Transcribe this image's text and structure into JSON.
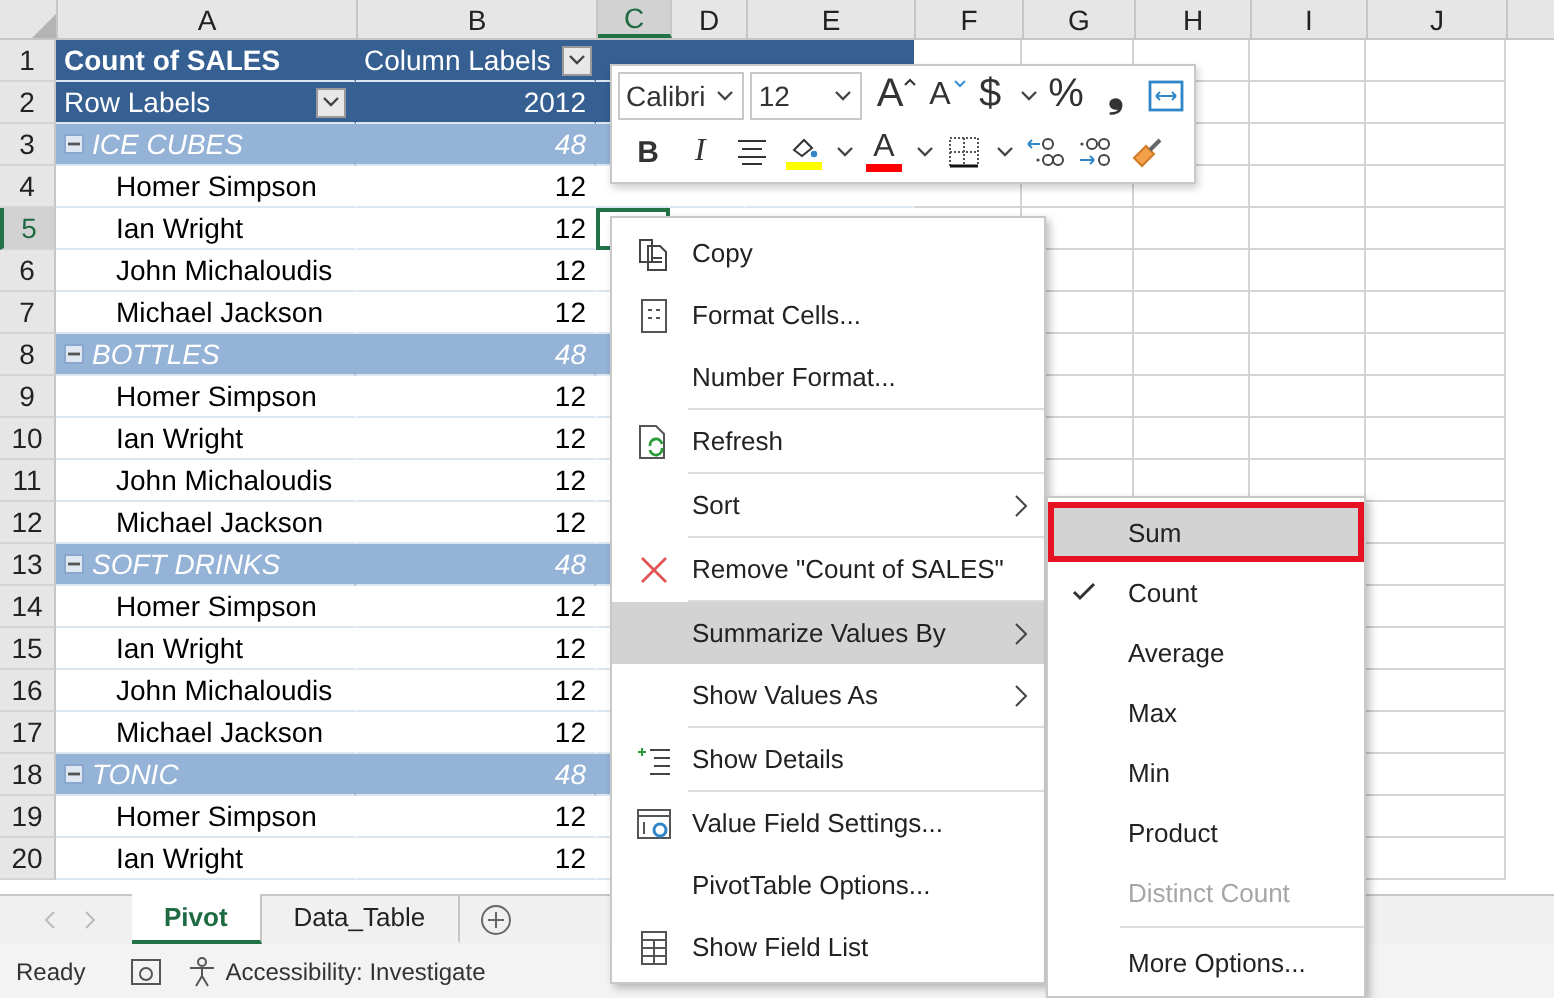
{
  "columns": [
    {
      "label": "A",
      "selected": false
    },
    {
      "label": "B",
      "selected": false
    },
    {
      "label": "C",
      "selected": true
    },
    {
      "label": "D",
      "selected": false
    },
    {
      "label": "E",
      "selected": false
    },
    {
      "label": "F",
      "selected": false
    },
    {
      "label": "G",
      "selected": false
    },
    {
      "label": "H",
      "selected": false
    },
    {
      "label": "I",
      "selected": false
    },
    {
      "label": "J",
      "selected": false
    }
  ],
  "rows": [
    {
      "number": "1",
      "kind": "title",
      "selected": false,
      "label": "Count of SALES",
      "value": "Column Labels",
      "filter": true
    },
    {
      "number": "2",
      "kind": "header",
      "selected": false,
      "label": "Row Labels",
      "value": "2012",
      "filter": true
    },
    {
      "number": "3",
      "kind": "group",
      "selected": false,
      "label": "ICE CUBES",
      "value": "48",
      "expanded": true
    },
    {
      "number": "4",
      "kind": "item",
      "selected": false,
      "label": "Homer Simpson",
      "value": "12"
    },
    {
      "number": "5",
      "kind": "item",
      "selected": true,
      "label": "Ian Wright",
      "value": "12"
    },
    {
      "number": "6",
      "kind": "item",
      "selected": false,
      "label": "John Michaloudis",
      "value": "12"
    },
    {
      "number": "7",
      "kind": "item",
      "selected": false,
      "label": "Michael Jackson",
      "value": "12"
    },
    {
      "number": "8",
      "kind": "group",
      "selected": false,
      "label": "BOTTLES",
      "value": "48",
      "expanded": true
    },
    {
      "number": "9",
      "kind": "item",
      "selected": false,
      "label": "Homer Simpson",
      "value": "12"
    },
    {
      "number": "10",
      "kind": "item",
      "selected": false,
      "label": "Ian Wright",
      "value": "12"
    },
    {
      "number": "11",
      "kind": "item",
      "selected": false,
      "label": "John Michaloudis",
      "value": "12"
    },
    {
      "number": "12",
      "kind": "item",
      "selected": false,
      "label": "Michael Jackson",
      "value": "12"
    },
    {
      "number": "13",
      "kind": "group",
      "selected": false,
      "label": "SOFT DRINKS",
      "value": "48",
      "expanded": true
    },
    {
      "number": "14",
      "kind": "item",
      "selected": false,
      "label": "Homer Simpson",
      "value": "12"
    },
    {
      "number": "15",
      "kind": "item",
      "selected": false,
      "label": "Ian Wright",
      "value": "12"
    },
    {
      "number": "16",
      "kind": "item",
      "selected": false,
      "label": "John Michaloudis",
      "value": "12"
    },
    {
      "number": "17",
      "kind": "item",
      "selected": false,
      "label": "Michael Jackson",
      "value": "12"
    },
    {
      "number": "18",
      "kind": "group",
      "selected": false,
      "label": "TONIC",
      "value": "48",
      "expanded": true
    },
    {
      "number": "19",
      "kind": "item",
      "selected": false,
      "label": "Homer Simpson",
      "value": "12"
    },
    {
      "number": "20",
      "kind": "item",
      "selected": false,
      "label": "Ian Wright",
      "value": "12"
    }
  ],
  "mini_toolbar": {
    "font": "Calibri",
    "size": "12",
    "row_1": [
      {
        "kind": "grow",
        "glyph": "A"
      },
      {
        "kind": "shrink",
        "glyph": "A"
      },
      {
        "kind": "glyph",
        "glyph": "$"
      },
      {
        "kind": "chevron"
      },
      {
        "kind": "glyph",
        "glyph": "%"
      },
      {
        "kind": "glyph",
        "glyph": "❟"
      },
      {
        "kind": "wrap"
      }
    ],
    "row_2": [
      {
        "kind": "bold",
        "glyph": "B"
      },
      {
        "kind": "italic",
        "glyph": "I"
      },
      {
        "kind": "align"
      },
      {
        "kind": "fill",
        "color": "#ffff00"
      },
      {
        "kind": "chevron"
      },
      {
        "kind": "fontcolor",
        "glyph": "A",
        "color": "#ff0000"
      },
      {
        "kind": "chevron"
      },
      {
        "kind": "borders"
      },
      {
        "kind": "chevron"
      },
      {
        "kind": "incdec"
      },
      {
        "kind": "decdec"
      },
      {
        "kind": "painter"
      }
    ]
  },
  "context_menu": [
    {
      "kind": "copy",
      "label": "Copy",
      "selected": false,
      "submenu": false
    },
    {
      "kind": "format",
      "label": "Format Cells...",
      "selected": false,
      "submenu": false
    },
    {
      "kind": "plain",
      "label": "Number Format...",
      "selected": false,
      "submenu": false
    },
    {
      "kind": "separator"
    },
    {
      "kind": "refresh",
      "label": "Refresh",
      "selected": false,
      "submenu": false
    },
    {
      "kind": "separator"
    },
    {
      "kind": "plain",
      "label": "Sort",
      "selected": false,
      "submenu": true
    },
    {
      "kind": "separator"
    },
    {
      "kind": "remove",
      "label": "Remove \"Count of SALES\"",
      "selected": false,
      "submenu": false
    },
    {
      "kind": "separator"
    },
    {
      "kind": "plain",
      "label": "Summarize Values By",
      "selected": true,
      "submenu": true
    },
    {
      "kind": "plain",
      "label": "Show Values As",
      "selected": false,
      "submenu": true
    },
    {
      "kind": "separator"
    },
    {
      "kind": "details",
      "label": "Show Details",
      "selected": false,
      "submenu": false
    },
    {
      "kind": "separator"
    },
    {
      "kind": "settings",
      "label": "Value Field Settings...",
      "selected": false,
      "submenu": false
    },
    {
      "kind": "plain",
      "label": "PivotTable Options...",
      "selected": false,
      "submenu": false
    },
    {
      "kind": "fieldlist",
      "label": "Show Field List",
      "selected": false,
      "submenu": false
    }
  ],
  "submenu": [
    {
      "kind": "option",
      "label": "Sum",
      "selected": true,
      "checked": false,
      "disabled": false,
      "boxed": true
    },
    {
      "kind": "option",
      "label": "Count",
      "selected": false,
      "checked": true,
      "disabled": false,
      "boxed": false
    },
    {
      "kind": "option",
      "label": "Average",
      "selected": false,
      "checked": false,
      "disabled": false,
      "boxed": false
    },
    {
      "kind": "option",
      "label": "Max",
      "selected": false,
      "checked": false,
      "disabled": false,
      "boxed": false
    },
    {
      "kind": "option",
      "label": "Min",
      "selected": false,
      "checked": false,
      "disabled": false,
      "boxed": false
    },
    {
      "kind": "option",
      "label": "Product",
      "selected": false,
      "checked": false,
      "disabled": false,
      "boxed": false
    },
    {
      "kind": "option",
      "label": "Distinct Count",
      "selected": false,
      "checked": false,
      "disabled": true,
      "boxed": false
    },
    {
      "kind": "separator"
    },
    {
      "kind": "option",
      "label": "More Options...",
      "selected": false,
      "checked": false,
      "disabled": false,
      "boxed": false
    }
  ],
  "sheet_tabs": [
    {
      "label": "Pivot",
      "selected": true
    },
    {
      "label": "Data_Table",
      "selected": false
    }
  ],
  "status_bar": {
    "status": "Ready",
    "accessibility": "Accessibility: Investigate"
  }
}
